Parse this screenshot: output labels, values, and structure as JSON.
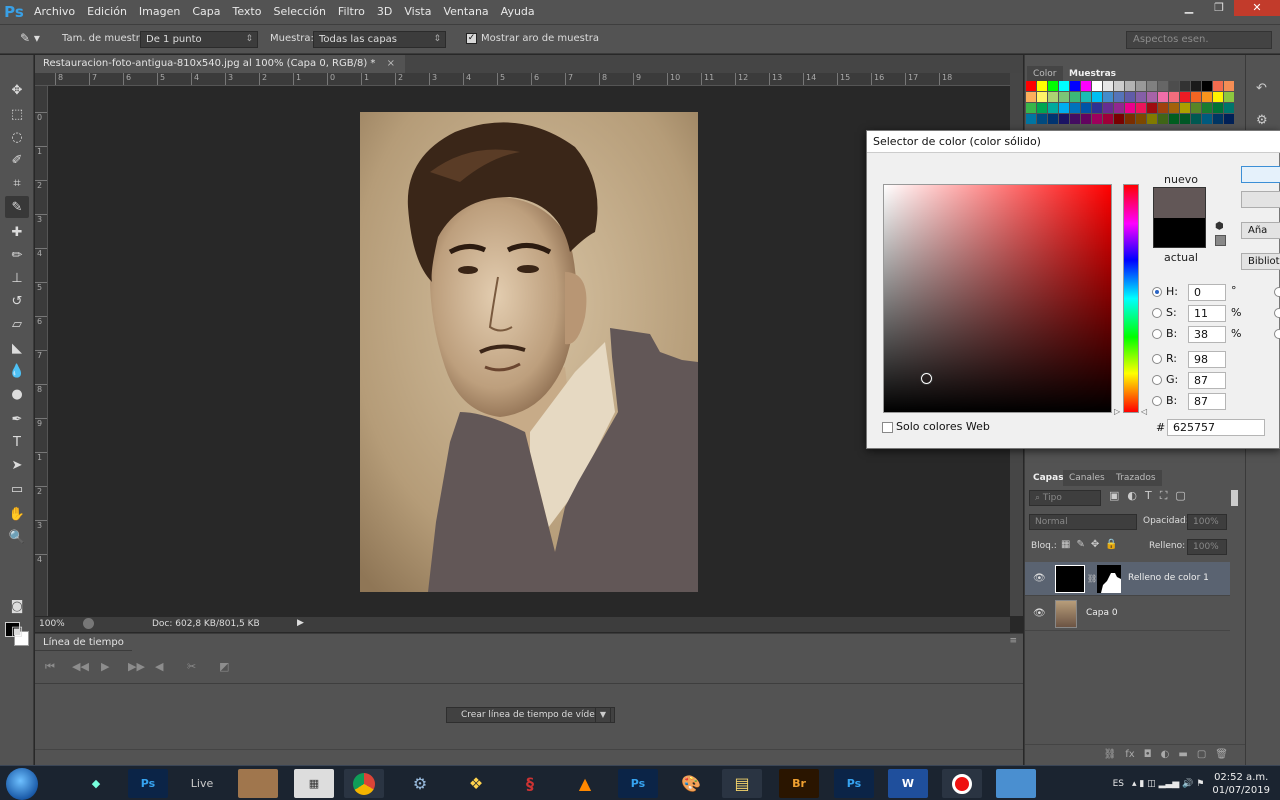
{
  "app": {
    "logo": "Ps"
  },
  "menu": [
    "Archivo",
    "Edición",
    "Imagen",
    "Capa",
    "Texto",
    "Selección",
    "Filtro",
    "3D",
    "Vista",
    "Ventana",
    "Ayuda"
  ],
  "window_controls": {
    "minimize": "▁",
    "restore": "❐",
    "close": "✕"
  },
  "options": {
    "sample_size_label": "Tam. de muestra:",
    "sample_size_value": "De 1 punto",
    "sample_label": "Muestra:",
    "sample_value": "Todas las capas",
    "show_ring_label": "Mostrar aro de muestra",
    "show_ring_checked": true,
    "workspace": "Aspectos esen."
  },
  "document": {
    "tab_title": "Restauracion-foto-antigua-810x540.jpg al 100% (Capa 0, RGB/8) *",
    "zoom": "100%",
    "doc_info": "Doc: 602,8 KB/801,5 KB",
    "fill_color": "#625757"
  },
  "ruler": {
    "h_labels": [
      "8",
      "7",
      "6",
      "5",
      "4",
      "3",
      "2",
      "1",
      "0",
      "1",
      "2",
      "3",
      "4",
      "5",
      "6",
      "7",
      "8",
      "9",
      "10",
      "11",
      "12",
      "13",
      "14",
      "15",
      "16",
      "17",
      "18"
    ],
    "v_labels": [
      "0",
      "1",
      "2",
      "3",
      "4",
      "5",
      "6",
      "7",
      "8",
      "9",
      "1",
      "2",
      "3",
      "4"
    ]
  },
  "timeline": {
    "tab": "Línea de tiempo",
    "create_button": "Crear línea de tiempo de vídeo",
    "controls": [
      "first-frame-icon",
      "previous-frame-icon",
      "play-icon",
      "next-frame-icon",
      "audio-icon",
      "split-icon",
      "transition-icon"
    ]
  },
  "color_panel": {
    "tabs": [
      "Color",
      "Muestras"
    ],
    "active_tab": "Muestras"
  },
  "layers_panel": {
    "tabs": [
      "Capas",
      "Canales",
      "Trazados"
    ],
    "filter_placeholder": "Tipo",
    "blend_mode": "Normal",
    "opacity_label": "Opacidad:",
    "opacity_value": "100%",
    "lock_label": "Bloq.:",
    "fill_label": "Relleno:",
    "fill_value": "100%",
    "layers": [
      {
        "name": "Relleno de color 1",
        "selected": true
      },
      {
        "name": "Capa 0",
        "selected": false
      }
    ]
  },
  "color_picker": {
    "title": "Selector de color (color sólido)",
    "new_label": "nuevo",
    "current_label": "actual",
    "new_color": "#625757",
    "current_color": "#000000",
    "hsb": [
      {
        "label": "H:",
        "value": "0",
        "unit": "°",
        "selected": true
      },
      {
        "label": "S:",
        "value": "11",
        "unit": "%",
        "selected": false
      },
      {
        "label": "B:",
        "value": "38",
        "unit": "%",
        "selected": false
      }
    ],
    "rgb": [
      {
        "label": "R:",
        "value": "98"
      },
      {
        "label": "G:",
        "value": "87"
      },
      {
        "label": "B:",
        "value": "87"
      }
    ],
    "hex_label": "#",
    "hex_value": "625757",
    "web_only_label": "Solo colores Web",
    "buttons": [
      "",
      "",
      "Aña",
      "Bibliot"
    ]
  },
  "taskbar": {
    "apps": [
      "Ps",
      "Live",
      "Ps",
      "Br",
      "Ps",
      "W"
    ],
    "lang": "ES",
    "time": "02:52 a.m.",
    "date": "01/07/2019"
  }
}
